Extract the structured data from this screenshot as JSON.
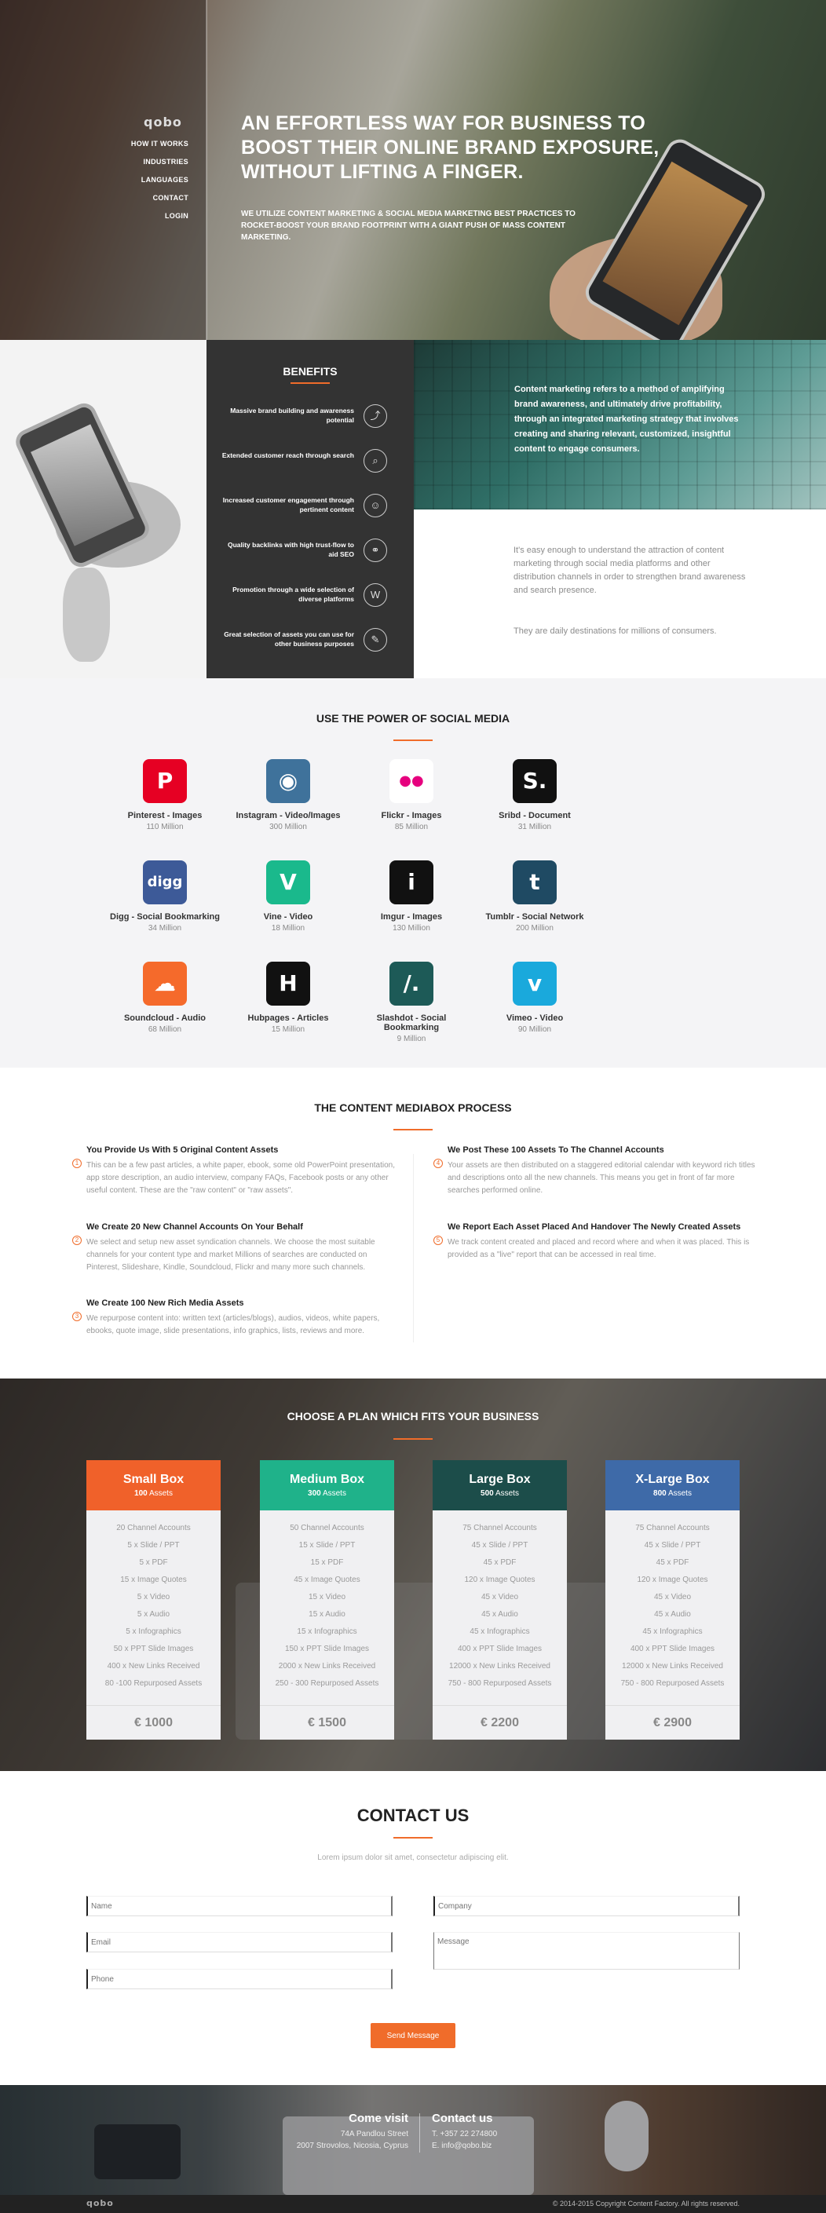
{
  "brand": {
    "logo": "qobo",
    "accent": "#f06c2a"
  },
  "nav": {
    "items": [
      "HOW IT WORKS",
      "INDUSTRIES",
      "LANGUAGES",
      "CONTACT",
      "LOGIN"
    ]
  },
  "hero": {
    "title": "AN EFFORTLESS WAY FOR BUSINESS TO BOOST THEIR ONLINE BRAND EXPOSURE, WITHOUT LIFTING A FINGER.",
    "subtitle": "WE UTILIZE CONTENT MARKETING & SOCIAL MEDIA MARKETING BEST PRACTICES TO ROCKET-BOOST YOUR BRAND FOOTPRINT WITH  A GIANT PUSH OF MASS CONTENT MARKETING."
  },
  "benefits": {
    "title": "BENEFITS",
    "items": [
      {
        "text": "Massive brand building and awareness potential",
        "icon": "chart-icon",
        "glyph": "⤴"
      },
      {
        "text": "Extended customer reach through search",
        "icon": "search-icon",
        "glyph": "⌕"
      },
      {
        "text": "Increased customer engagement through pertinent content",
        "icon": "people-icon",
        "glyph": "☺"
      },
      {
        "text": "Quality backlinks with high trust-flow to aid SEO",
        "icon": "link-icon",
        "glyph": "⚭"
      },
      {
        "text": "Promotion through a wide selection of diverse platforms",
        "icon": "w-icon",
        "glyph": "W"
      },
      {
        "text": "Great selection of assets you can use for other business purposes",
        "icon": "edit-icon",
        "glyph": "✎"
      }
    ]
  },
  "content_marketing": {
    "para1": "Content marketing refers to a method of amplifying brand awareness, and ultimately drive profitability, through an integrated marketing strategy that involves creating and sharing relevant, customized, insightful content to engage consumers.",
    "para2": "It's easy enough to understand the attraction of content marketing through social media platforms and other distribution channels in order to strengthen brand awareness and search presence.",
    "para3": "They are daily destinations for millions of consumers."
  },
  "social": {
    "title": "USE THE POWER OF SOCIAL MEDIA",
    "items": [
      {
        "name": "Pinterest - Images",
        "count": "110 Million",
        "color": "#e60023",
        "glyph": "P",
        "icon": "pinterest-icon"
      },
      {
        "name": "Instagram - Video/Images",
        "count": "300 Million",
        "color": "#3f729b",
        "glyph": "◉",
        "icon": "instagram-icon"
      },
      {
        "name": "Flickr - Images",
        "count": "85 Million",
        "color": "#ffffff",
        "glyph": "●●",
        "icon": "flickr-icon"
      },
      {
        "name": "Sribd - Document",
        "count": "31 Million",
        "color": "#111111",
        "glyph": "S.",
        "icon": "scribd-icon"
      },
      {
        "name": "Digg - Social Bookmarking",
        "count": "34 Million",
        "color": "#3d5a98",
        "glyph": "digg",
        "icon": "digg-icon"
      },
      {
        "name": "Vine - Video",
        "count": "18 Million",
        "color": "#1ab98c",
        "glyph": "V",
        "icon": "vine-icon"
      },
      {
        "name": "Imgur - Images",
        "count": "130 Million",
        "color": "#111111",
        "glyph": "i",
        "icon": "imgur-icon"
      },
      {
        "name": "Tumblr - Social Network",
        "count": "200 Million",
        "color": "#1f4a63",
        "glyph": "t",
        "icon": "tumblr-icon"
      },
      {
        "name": "Soundcloud - Audio",
        "count": "68 Million",
        "color": "#f56a2b",
        "glyph": "☁",
        "icon": "soundcloud-icon"
      },
      {
        "name": "Hubpages - Articles",
        "count": "15 Million",
        "color": "#111111",
        "glyph": "H",
        "icon": "hubpages-icon"
      },
      {
        "name": "Slashdot - Social Bookmarking",
        "count": "9 Million",
        "color": "#1d5a57",
        "glyph": "/.",
        "icon": "slashdot-icon"
      },
      {
        "name": "Vimeo - Video",
        "count": "90 Million",
        "color": "#1aa9dc",
        "glyph": "v",
        "icon": "vimeo-icon"
      }
    ]
  },
  "process": {
    "title": "THE CONTENT MEDIABOX PROCESS",
    "steps": [
      {
        "num": "1",
        "title": "You Provide Us With 5 Original Content Assets",
        "text": "This can be a few past articles, a white paper, ebook, some old PowerPoint presentation, app store description, an audio interview, company FAQs, Facebook posts or any other useful content. These are the \"raw content\" or \"raw assets\"."
      },
      {
        "num": "2",
        "title": "We Create 20 New Channel Accounts On Your Behalf",
        "text": "We select and setup new asset syndication channels. We choose the most suitable channels for your content type and market Millions of searches are conducted on Pinterest, Slideshare, Kindle, Soundcloud, Flickr and many more such channels."
      },
      {
        "num": "3",
        "title": "We Create 100 New Rich Media Assets",
        "text": "We repurpose content into: written text (articles/blogs), audios, videos, white papers, ebooks, quote image, slide presentations, info graphics, lists, reviews and more."
      },
      {
        "num": "4",
        "title": "We Post These 100 Assets To The Channel Accounts",
        "text": "Your assets are then distributed on a staggered editorial calendar with keyword rich titles and descriptions onto all the new channels. This means you get in front of far more searches performed online."
      },
      {
        "num": "5",
        "title": "We Report Each Asset Placed And Handover The Newly Created Assets",
        "text": "We track content created and placed and record where and when it was placed. This is provided as a \"live\" report that can be accessed in real time."
      }
    ]
  },
  "pricing": {
    "title": "CHOOSE A PLAN WHICH FITS YOUR BUSINESS",
    "plans": [
      {
        "name": "Small Box",
        "assets_num": "100",
        "assets_label": "Assets",
        "color": "#f0612a",
        "features": [
          "20 Channel Accounts",
          "5 x Slide / PPT",
          "5 x PDF",
          "15 x Image Quotes",
          "5 x Video",
          "5 x Audio",
          "5 x Infographics",
          "50 x PPT Slide Images",
          "400 x New Links Received",
          "80 -100 Repurposed Assets"
        ],
        "price": "€ 1000"
      },
      {
        "name": "Medium Box",
        "assets_num": "300",
        "assets_label": "Assets",
        "color": "#1fb28a",
        "features": [
          "50 Channel Accounts",
          "15 x Slide / PPT",
          "15 x PDF",
          "45 x Image Quotes",
          "15 x Video",
          "15 x Audio",
          "15 x Infographics",
          "150 x PPT Slide Images",
          "2000 x New Links Received",
          "250 - 300 Repurposed Assets"
        ],
        "price": "€ 1500"
      },
      {
        "name": "Large Box",
        "assets_num": "500",
        "assets_label": "Assets",
        "color": "#1c4d4a",
        "features": [
          "75 Channel Accounts",
          "45 x Slide / PPT",
          "45 x PDF",
          "120 x Image Quotes",
          "45 x Video",
          "45 x Audio",
          "45 x Infographics",
          "400 x PPT Slide Images",
          "12000 x New Links Received",
          "750 - 800 Repurposed Assets"
        ],
        "price": "€ 2200"
      },
      {
        "name": "X-Large Box",
        "assets_num": "800",
        "assets_label": "Assets",
        "color": "#3e6aa8",
        "features": [
          "75 Channel Accounts",
          "45 x Slide / PPT",
          "45 x PDF",
          "120 x Image Quotes",
          "45 x Video",
          "45 x Audio",
          "45 x Infographics",
          "400 x PPT Slide Images",
          "12000 x New Links Received",
          "750 - 800 Repurposed Assets"
        ],
        "price": "€ 2900"
      }
    ]
  },
  "contact": {
    "title": "CONTACT US",
    "subtitle": "Lorem ipsum dolor sit amet, consectetur adipiscing elit.",
    "placeholders": {
      "name": "Name",
      "email": "Email",
      "phone": "Phone",
      "company": "Company",
      "message": "Message"
    },
    "send": "Send Message"
  },
  "footer": {
    "visit_title": "Come visit",
    "visit_lines": [
      "74A Pandlou Street",
      "2007 Strovolos, Nicosia, Cyprus"
    ],
    "contact_title": "Contact us",
    "contact_lines": [
      "T. +357 22 274800",
      "E. info@qobo.biz"
    ],
    "logo": "qobo",
    "copyright": "© 2014-2015 Copyright Content Factory. All rights reserved."
  }
}
